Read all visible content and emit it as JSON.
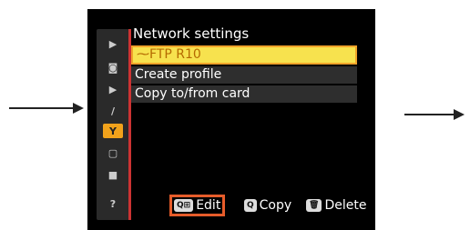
{
  "screen": {
    "title": "Network settings",
    "menu_items": [
      {
        "label": "FTP R10",
        "selected": true
      },
      {
        "label": "Create profile",
        "selected": false
      },
      {
        "label": "Copy to/from card",
        "selected": false
      }
    ],
    "icon_bar": [
      {
        "name": "playback-icon",
        "glyph": "▶"
      },
      {
        "name": "camera-icon",
        "glyph": "◙"
      },
      {
        "name": "movie-icon",
        "glyph": "▶"
      },
      {
        "name": "pencil-icon",
        "glyph": "/"
      },
      {
        "name": "wrench-icon",
        "glyph": "Y",
        "selected": true
      },
      {
        "name": "retouch-icon",
        "glyph": "▢"
      },
      {
        "name": "mymenu-icon",
        "glyph": "■"
      },
      {
        "name": "help-icon",
        "glyph": "?"
      }
    ],
    "bottom_bar": {
      "edit_key": "Q⊞",
      "edit_label": "Edit",
      "copy_key": "Q",
      "copy_label": "Copy",
      "delete_key": "🗑",
      "delete_label": "Delete"
    },
    "colors": {
      "selected_bg": "#f7e24e",
      "selected_text": "#b56a00",
      "highlight_border": "#e65c2a"
    }
  }
}
